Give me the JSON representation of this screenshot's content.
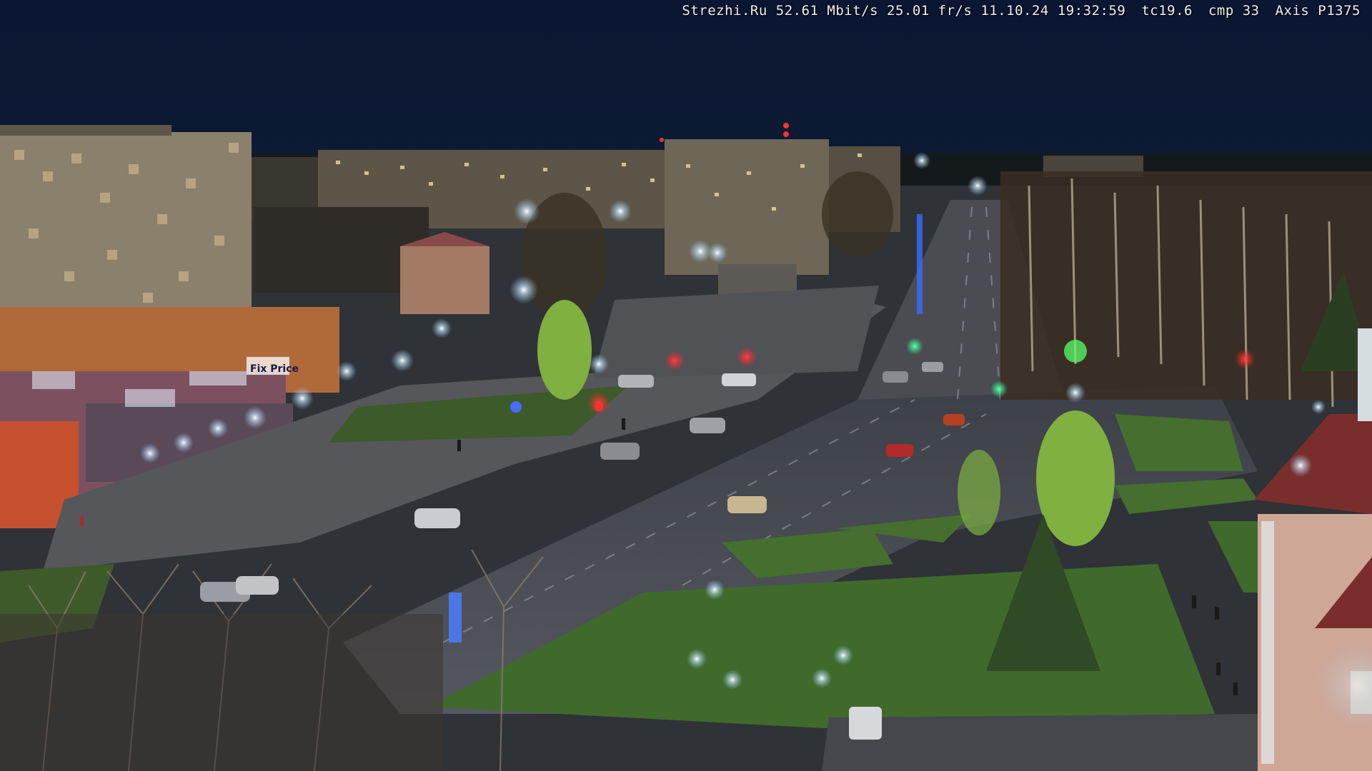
{
  "overlay": {
    "site": "Strezhi.Ru",
    "bitrate": "52.61 Mbit/s",
    "framerate": "25.01 fr/s",
    "date": "11.10.24",
    "time": "19:32:59",
    "temperature": "tc19.6",
    "compression": "cmp 33",
    "camera": "Axis P1375"
  },
  "signs": {
    "shop_sign": "Fix Price"
  },
  "colors": {
    "sky": "#0a1530",
    "road": "#4a4d54",
    "grass": "#3f6a2c",
    "building": "#8a7f6c",
    "streetlight": "#dff3ff"
  }
}
